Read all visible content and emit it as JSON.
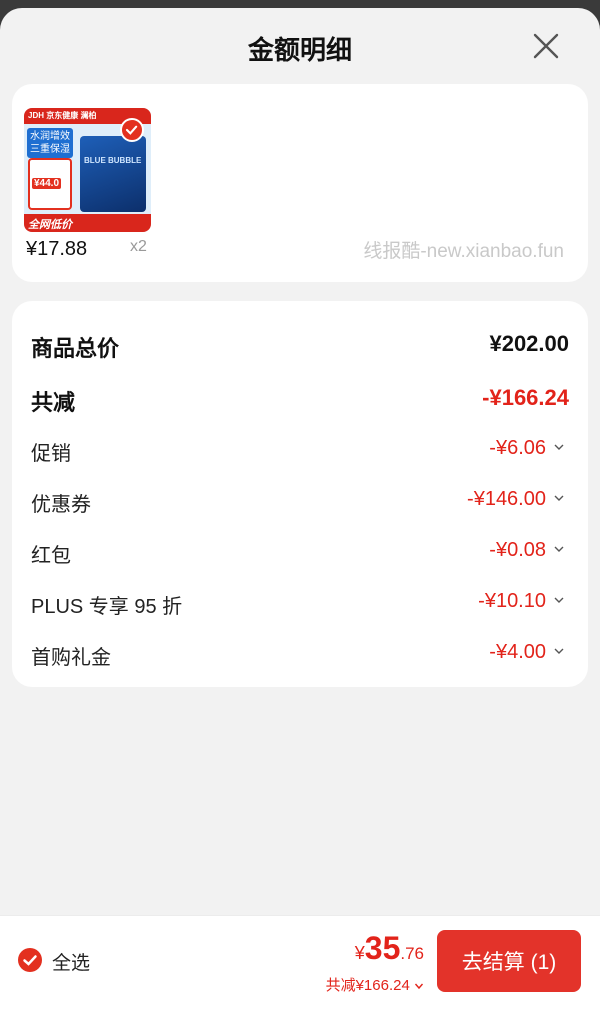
{
  "header": {
    "title": "金额明细"
  },
  "product": {
    "thumb_brand": "JDH 京东健康  澜柏",
    "thumb_slogan": "水润增效 三重保湿",
    "thumb_price": "¥44.0",
    "thumb_box_text": "BLUE BUBBLE",
    "thumb_bottom": "全网低价",
    "unit_price": "¥17.88",
    "quantity": "x2",
    "watermark": "线报酷-new.xianbao.fun"
  },
  "summary": {
    "total_label": "商品总价",
    "total_value": "¥202.00",
    "reduction_label": "共减",
    "reduction_value": "-¥166.24",
    "items": [
      {
        "label": "促销",
        "value": "-¥6.06"
      },
      {
        "label": "优惠券",
        "value": "-¥146.00"
      },
      {
        "label": "红包",
        "value": "-¥0.08"
      },
      {
        "label": "PLUS 专享 95 折",
        "value": "-¥10.10"
      },
      {
        "label": "首购礼金",
        "value": "-¥4.00"
      }
    ]
  },
  "footer": {
    "select_all": "全选",
    "currency": "¥",
    "amount_int": "35",
    "amount_dec": ".76",
    "saving": "共减¥166.24",
    "checkout": "去结算 (1)"
  },
  "colors": {
    "accent": "#e3332a",
    "price_red": "#e2231a",
    "background": "#f2f2f2"
  }
}
